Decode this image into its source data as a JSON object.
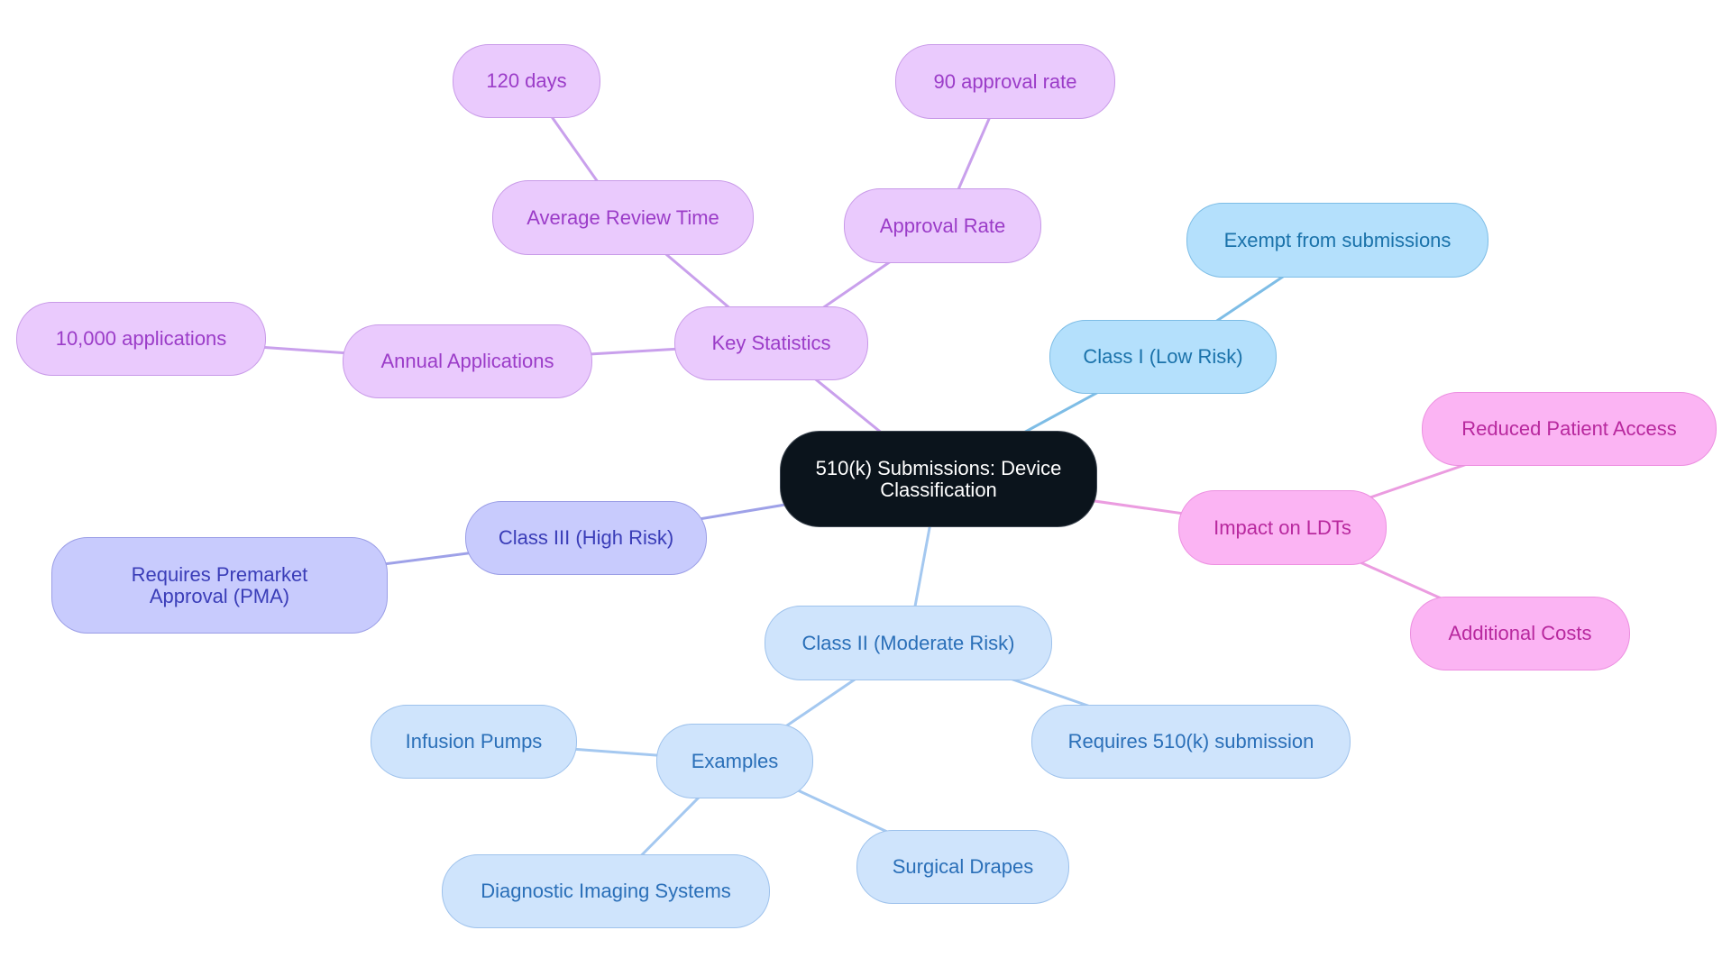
{
  "diagram": {
    "type": "mind-map",
    "root": {
      "id": "root",
      "label": "510(k) Submissions: Device Classification"
    },
    "nodes": [
      {
        "id": "keystats",
        "label": "Key Statistics",
        "parent": "root",
        "branch": "purple"
      },
      {
        "id": "avgreview",
        "label": "Average Review Time",
        "parent": "keystats",
        "branch": "purple"
      },
      {
        "id": "days120",
        "label": "120 days",
        "parent": "avgreview",
        "branch": "purple"
      },
      {
        "id": "approval",
        "label": "Approval Rate",
        "parent": "keystats",
        "branch": "purple"
      },
      {
        "id": "rate90",
        "label": "90 approval rate",
        "parent": "approval",
        "branch": "purple"
      },
      {
        "id": "annual",
        "label": "Annual Applications",
        "parent": "keystats",
        "branch": "purple"
      },
      {
        "id": "apps10k",
        "label": "10,000 applications",
        "parent": "annual",
        "branch": "purple"
      },
      {
        "id": "class1",
        "label": "Class I (Low Risk)",
        "parent": "root",
        "branch": "sky"
      },
      {
        "id": "exempt",
        "label": "Exempt from submissions",
        "parent": "class1",
        "branch": "sky"
      },
      {
        "id": "ldt",
        "label": "Impact on LDTs",
        "parent": "root",
        "branch": "pink"
      },
      {
        "id": "reduced",
        "label": "Reduced Patient Access",
        "parent": "ldt",
        "branch": "pink"
      },
      {
        "id": "costs",
        "label": "Additional Costs",
        "parent": "ldt",
        "branch": "pink"
      },
      {
        "id": "class3",
        "label": "Class III (High Risk)",
        "parent": "root",
        "branch": "indigo"
      },
      {
        "id": "pma",
        "label": "Requires Premarket Approval (PMA)",
        "parent": "class3",
        "branch": "indigo"
      },
      {
        "id": "class2",
        "label": "Class II (Moderate Risk)",
        "parent": "root",
        "branch": "lblue"
      },
      {
        "id": "req510",
        "label": "Requires 510(k) submission",
        "parent": "class2",
        "branch": "lblue"
      },
      {
        "id": "examples",
        "label": "Examples",
        "parent": "class2",
        "branch": "lblue"
      },
      {
        "id": "infusion",
        "label": "Infusion Pumps",
        "parent": "examples",
        "branch": "lblue"
      },
      {
        "id": "diag",
        "label": "Diagnostic Imaging Systems",
        "parent": "examples",
        "branch": "lblue"
      },
      {
        "id": "drapes",
        "label": "Surgical Drapes",
        "parent": "examples",
        "branch": "lblue"
      }
    ],
    "branch_colors": {
      "purple": {
        "fill": "#eacafd",
        "stroke": "#c89ae8",
        "text": "#9b3cc8",
        "edge": "#c9a0ec"
      },
      "sky": {
        "fill": "#b4e0fc",
        "stroke": "#7dbde6",
        "text": "#1a72aa",
        "edge": "#7ebde6"
      },
      "pink": {
        "fill": "#fbb4f3",
        "stroke": "#ec8fe0",
        "text": "#b8289e",
        "edge": "#eb9ce0"
      },
      "indigo": {
        "fill": "#c8cbfd",
        "stroke": "#9a9de6",
        "text": "#3a3db8",
        "edge": "#9ea1e8"
      },
      "lblue": {
        "fill": "#cfe4fc",
        "stroke": "#9ec2ec",
        "text": "#2a6fb8",
        "edge": "#a4c8f0"
      }
    },
    "root_colors": {
      "fill": "#0b141c",
      "text": "#ffffff"
    }
  }
}
